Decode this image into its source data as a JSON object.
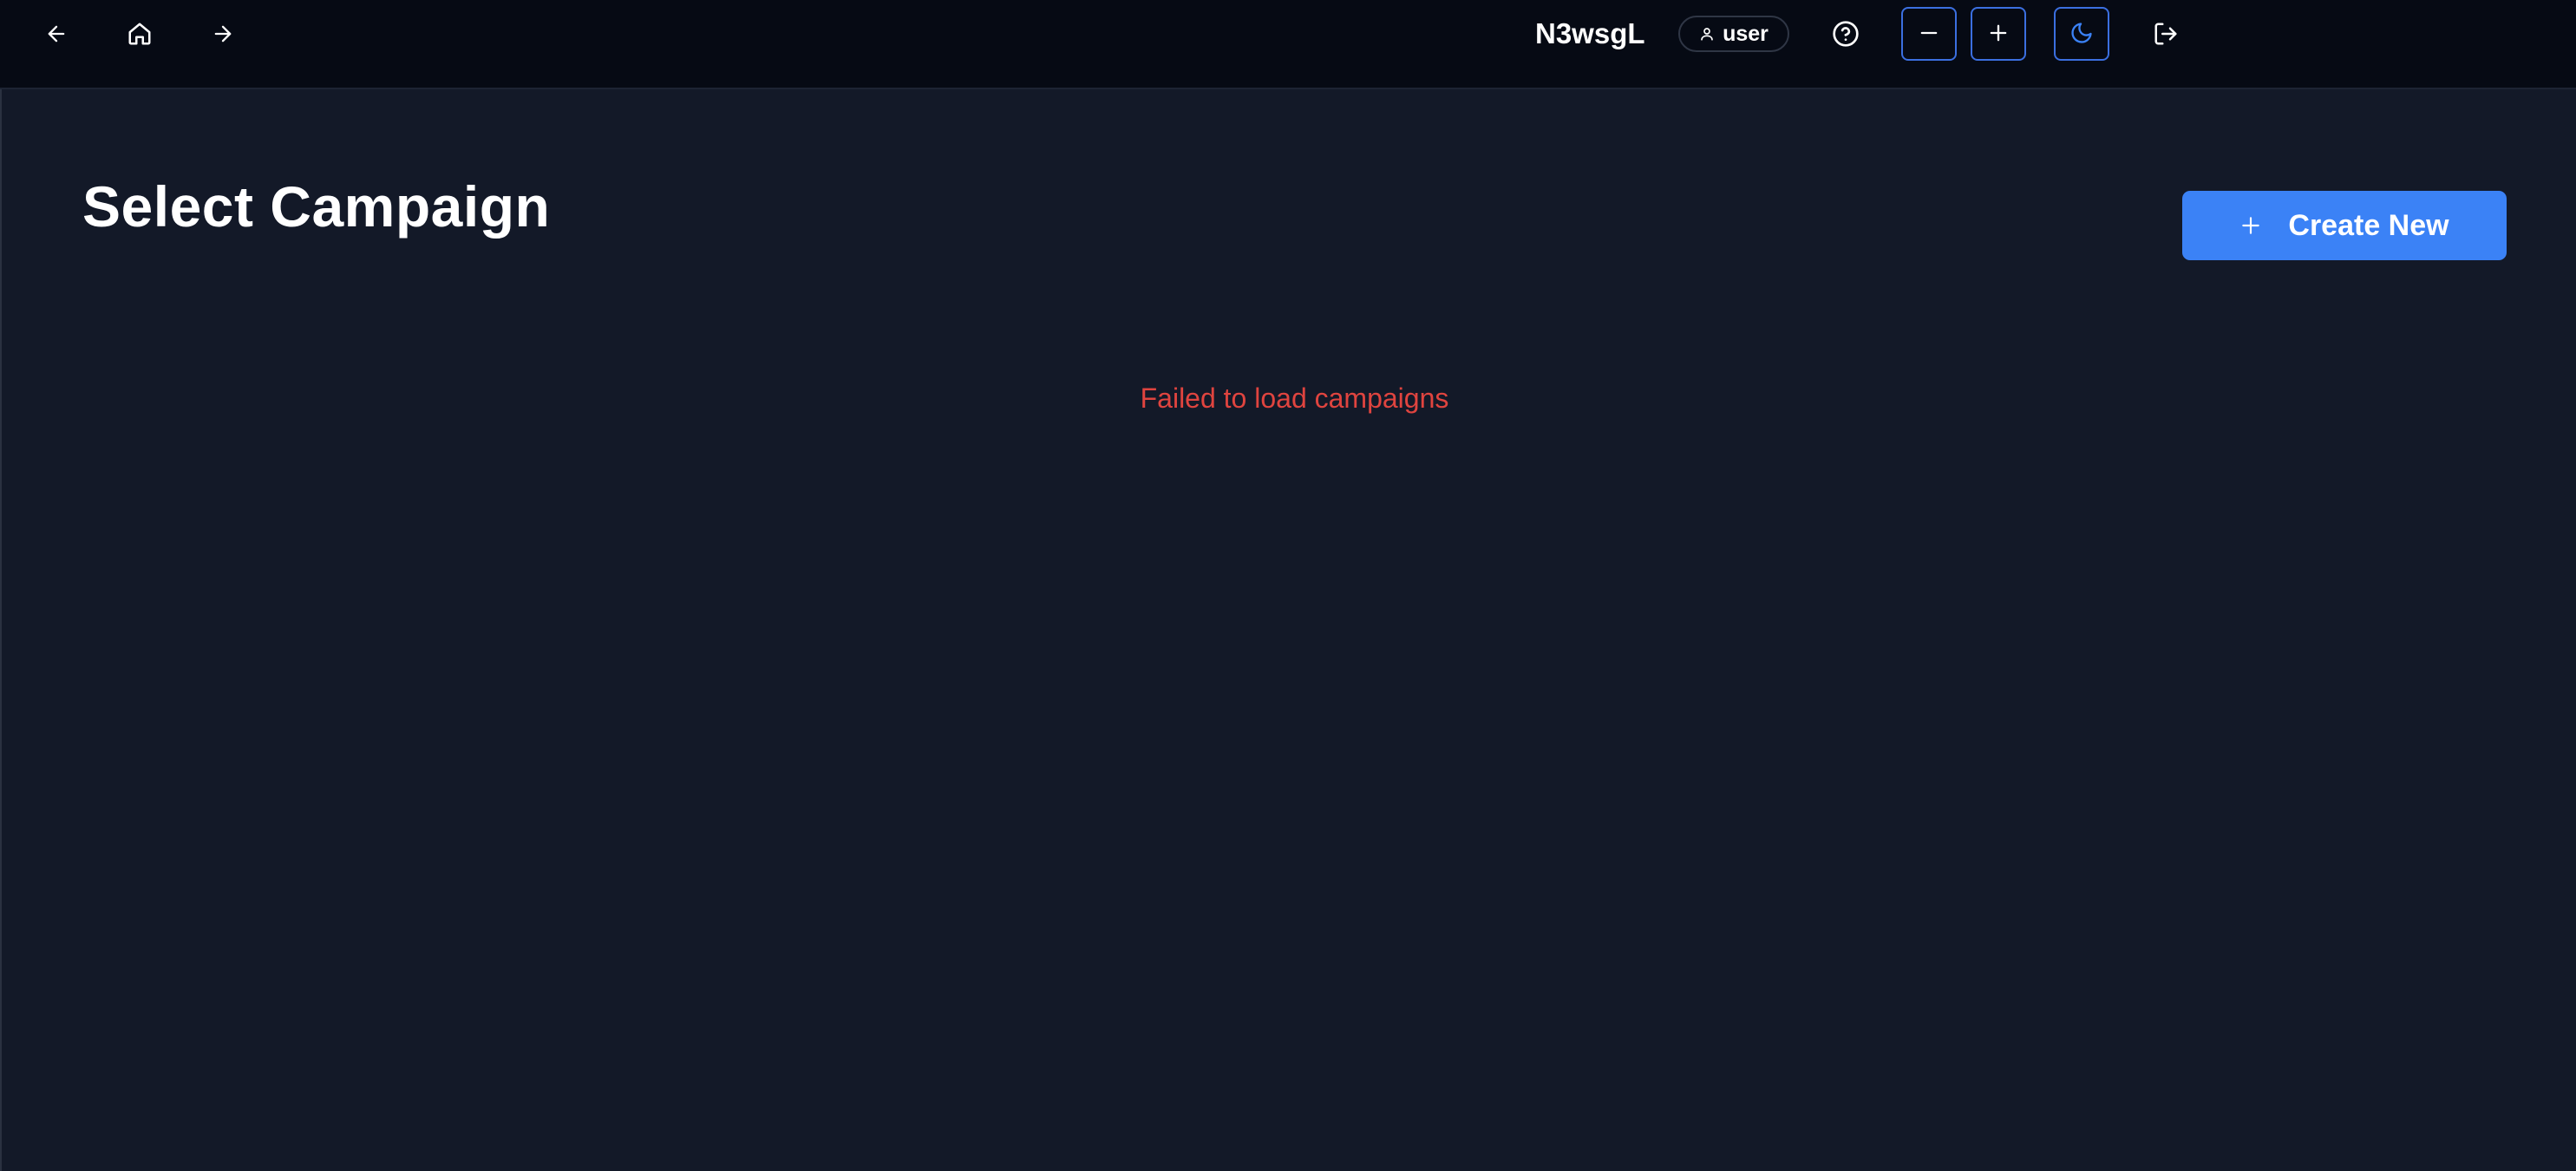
{
  "header": {
    "app_name": "N3wsgL",
    "user_label": "user",
    "icons": {
      "back": "arrow-left-icon",
      "home": "home-icon",
      "forward": "arrow-right-icon",
      "user": "user-icon",
      "help": "help-circle-icon",
      "zoom_out": "minus-icon",
      "zoom_in": "plus-icon",
      "theme": "moon-icon",
      "logout": "logout-icon"
    }
  },
  "main": {
    "title": "Select Campaign",
    "create_button_label": "Create New",
    "error_message": "Failed to load campaigns"
  },
  "colors": {
    "background": "#131928",
    "topbar": "#060a14",
    "accent": "#3b82f6",
    "error": "#e0443f",
    "button_border": "#3b6fe0"
  }
}
